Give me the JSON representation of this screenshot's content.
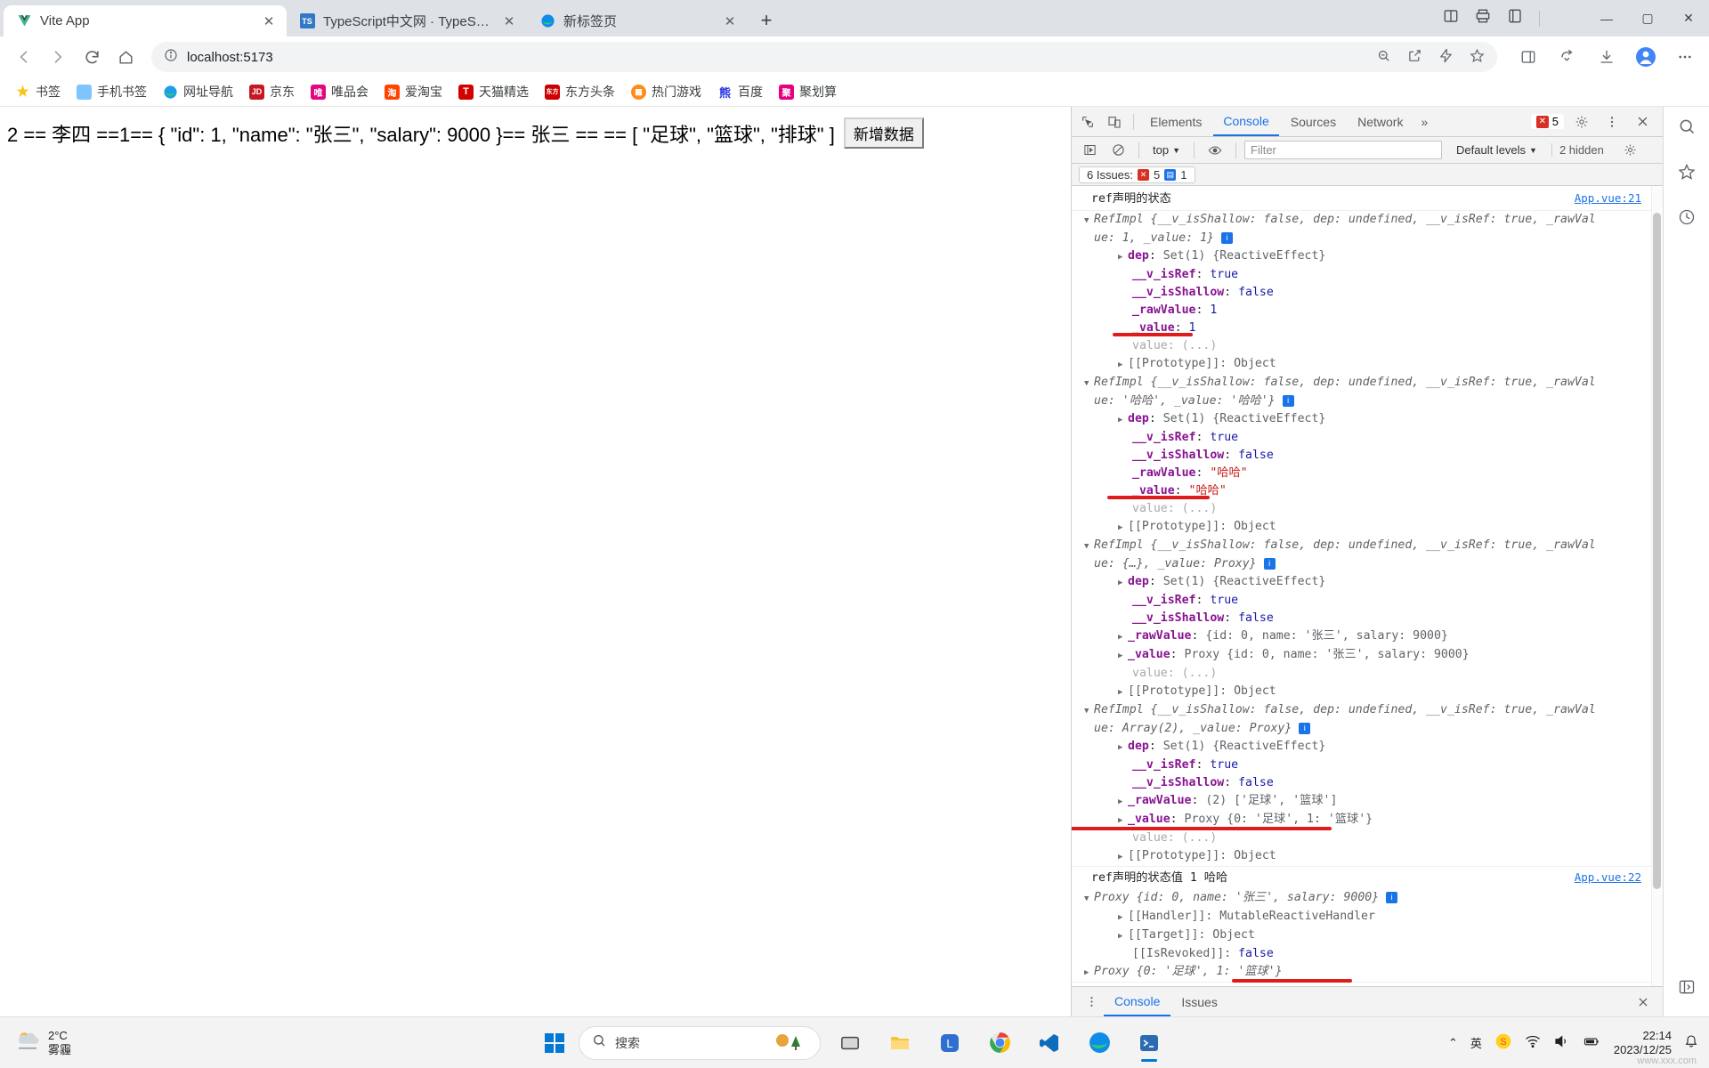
{
  "browser": {
    "tabs": [
      {
        "title": "Vite App",
        "favicon": "vue-logo-icon",
        "active": true
      },
      {
        "title": "TypeScript中文网 · TypeScript—",
        "favicon": "typescript-icon",
        "active": false
      },
      {
        "title": "新标签页",
        "favicon": "edge-icon",
        "active": false
      }
    ],
    "new_tab_label": "+",
    "window_controls": {
      "minimize": "—",
      "maximize": "▢",
      "close": "✕"
    },
    "toolbar": {
      "back": "←",
      "forward": "→",
      "reload": "⟳",
      "home": "⌂",
      "url": "localhost:5173",
      "site_info_icon": "info-circle-icon"
    },
    "bookmarks": [
      {
        "label": "书签",
        "icon": "star-icon",
        "color": "#f5c518",
        "glyph": "★"
      },
      {
        "label": "手机书签",
        "icon": "phone-icon",
        "color": "#7fc4fd",
        "glyph": "▯"
      },
      {
        "label": "网址导航",
        "icon": "edge-icon",
        "color": "#19b9e8",
        "glyph": "e"
      },
      {
        "label": "京东",
        "icon": "jd-icon",
        "color": "#c81623",
        "glyph": "JD"
      },
      {
        "label": "唯品会",
        "icon": "vip-icon",
        "color": "#e10682",
        "glyph": "唯"
      },
      {
        "label": "爱淘宝",
        "icon": "taobao-icon",
        "color": "#ff4400",
        "glyph": "淘"
      },
      {
        "label": "天猫精选",
        "icon": "tmall-icon",
        "color": "#d40000",
        "glyph": "T"
      },
      {
        "label": "东方头条",
        "icon": "dongfang-icon",
        "color": "#cc0000",
        "glyph": "东方"
      },
      {
        "label": "热门游戏",
        "icon": "games-icon",
        "color": "#ff8c1a",
        "glyph": "▦"
      },
      {
        "label": "百度",
        "icon": "baidu-icon",
        "color": "#2932e1",
        "glyph": "百"
      },
      {
        "label": "聚划算",
        "icon": "juhuasuan-icon",
        "color": "#e4007f",
        "glyph": "聚"
      }
    ]
  },
  "page": {
    "output_text": "2 == 李四 ==1== { \"id\": 1, \"name\": \"张三\", \"salary\": 9000 }== 张三 == == [ \"足球\", \"篮球\", \"排球\" ]",
    "button_label": "新增数据"
  },
  "devtools": {
    "tabs": [
      {
        "label": "Elements",
        "active": false
      },
      {
        "label": "Console",
        "active": true
      },
      {
        "label": "Sources",
        "active": false
      },
      {
        "label": "Network",
        "active": false
      }
    ],
    "more_tabs": "»",
    "inspect_icon": "inspect-cursor-icon",
    "device_icon": "device-toggle-icon",
    "error_count": "5",
    "settings_icon": "gear-icon",
    "menu_icon": "kebab-menu-icon",
    "close_icon": "close-icon",
    "toolbar2": {
      "execute_icon": "execute-snippet-icon",
      "clear_icon": "clear-console-icon",
      "context": "top",
      "eye_icon": "live-expression-icon",
      "filter_placeholder": "Filter",
      "levels": "Default levels",
      "hidden": "2 hidden"
    },
    "issues": {
      "prefix": "6 Issues:",
      "errors": "5",
      "infos": "1"
    },
    "logs": [
      {
        "group_title": "ref声明的状态",
        "source": "App.vue:21",
        "entries": [
          {
            "header_l1": "RefImpl {__v_isShallow: false, dep: undefined, __v_isRef: true, _rawVal",
            "header_l2": "ue: 1, _value: 1}",
            "props": [
              {
                "key": "dep",
                "value": "Set(1) {ReactiveEffect}",
                "expandable": true
              },
              {
                "key": "__v_isRef",
                "value": "true",
                "type": "bool"
              },
              {
                "key": "__v_isShallow",
                "value": "false",
                "type": "bool"
              },
              {
                "key": "_rawValue",
                "value": "1",
                "type": "num"
              },
              {
                "key": "_value",
                "value": "1",
                "type": "num",
                "underlined": true
              },
              {
                "key": "value",
                "value": "(...)",
                "faded": true
              },
              {
                "key": "[[Prototype]]",
                "value": "Object",
                "expandable": true,
                "proto": true
              }
            ]
          },
          {
            "header_l1": "RefImpl {__v_isShallow: false, dep: undefined, __v_isRef: true, _rawVal",
            "header_l2": "ue: '哈哈', _value: '哈哈'}",
            "props": [
              {
                "key": "dep",
                "value": "Set(1) {ReactiveEffect}",
                "expandable": true
              },
              {
                "key": "__v_isRef",
                "value": "true",
                "type": "bool"
              },
              {
                "key": "__v_isShallow",
                "value": "false",
                "type": "bool"
              },
              {
                "key": "_rawValue",
                "value": "\"哈哈\"",
                "type": "str"
              },
              {
                "key": "_value",
                "value": "\"哈哈\"",
                "type": "str",
                "underlined": true
              },
              {
                "key": "value",
                "value": "(...)",
                "faded": true
              },
              {
                "key": "[[Prototype]]",
                "value": "Object",
                "expandable": true,
                "proto": true
              }
            ]
          },
          {
            "header_l1": "RefImpl {__v_isShallow: false, dep: undefined, __v_isRef: true, _rawVal",
            "header_l2": "ue: {…}, _value: Proxy}",
            "props": [
              {
                "key": "dep",
                "value": "Set(1) {ReactiveEffect}",
                "expandable": true
              },
              {
                "key": "__v_isRef",
                "value": "true",
                "type": "bool"
              },
              {
                "key": "__v_isShallow",
                "value": "false",
                "type": "bool"
              },
              {
                "key": "_rawValue",
                "value": "{id: 0, name: '张三', salary: 9000}",
                "expandable": true
              },
              {
                "key": "_value",
                "value": "Proxy {id: 0, name: '张三', salary: 9000}",
                "expandable": true
              },
              {
                "key": "value",
                "value": "(...)",
                "faded": true
              },
              {
                "key": "[[Prototype]]",
                "value": "Object",
                "expandable": true,
                "proto": true
              }
            ]
          },
          {
            "header_l1": "RefImpl {__v_isShallow: false, dep: undefined, __v_isRef: true, _rawVal",
            "header_l2": "ue: Array(2), _value: Proxy}",
            "props": [
              {
                "key": "dep",
                "value": "Set(1) {ReactiveEffect}",
                "expandable": true
              },
              {
                "key": "__v_isRef",
                "value": "true",
                "type": "bool"
              },
              {
                "key": "__v_isShallow",
                "value": "false",
                "type": "bool"
              },
              {
                "key": "_rawValue",
                "value": "(2) ['足球', '篮球']",
                "expandable": true
              },
              {
                "key": "_value",
                "value": "Proxy {0: '足球', 1: '篮球'}",
                "expandable": true,
                "underlined": true
              },
              {
                "key": "value",
                "value": "(...)",
                "faded": true
              },
              {
                "key": "[[Prototype]]",
                "value": "Object",
                "expandable": true,
                "proto": true
              }
            ]
          }
        ]
      },
      {
        "group_title": "ref声明的状态值 1 哈哈",
        "source": "App.vue:22",
        "proxy_entries": [
          {
            "header": "Proxy {id: 0, name: '张三', salary: 9000}",
            "props": [
              {
                "key": "[[Handler]]",
                "value": "MutableReactiveHandler",
                "expandable": true
              },
              {
                "key": "[[Target]]",
                "value": "Object",
                "expandable": true
              },
              {
                "key": "[[IsRevoked]]",
                "value": "false",
                "type": "bool"
              }
            ]
          },
          {
            "header": "Proxy {0: '足球', 1: '篮球'}",
            "underlined": true,
            "props": []
          }
        ]
      }
    ],
    "prompt": ">",
    "drawer_tabs": [
      {
        "label": "Console",
        "active": true
      },
      {
        "label": "Issues",
        "active": false
      }
    ],
    "drawer_menu_icon": "kebab-menu-icon",
    "drawer_close_icon": "close-icon"
  },
  "rail": {
    "search_icon": "search-icon",
    "favorites_icon": "star-outline-icon",
    "history_icon": "clock-icon",
    "expand_icon": "panel-expand-icon"
  },
  "taskbar": {
    "weather": {
      "temp": "2°C",
      "condition": "雾霾",
      "icon": "haze-icon"
    },
    "start_icon": "windows-start-icon",
    "search_placeholder": "搜索",
    "search_icon": "search-icon",
    "apps": [
      {
        "name": "task-view",
        "glyph": "▭"
      },
      {
        "name": "file-explorer",
        "glyph": "🗀"
      },
      {
        "name": "line-app",
        "glyph": "L"
      },
      {
        "name": "chrome",
        "glyph": "◉"
      },
      {
        "name": "vscode",
        "glyph": "◈"
      },
      {
        "name": "edge",
        "glyph": "e"
      },
      {
        "name": "terminal",
        "glyph": "▣"
      }
    ],
    "tray": {
      "chevron": "⌃",
      "ime": "英",
      "app": "S",
      "wifi_icon": "wifi-icon",
      "volume_icon": "volume-icon",
      "battery_icon": "battery-icon"
    },
    "time": "22:14",
    "date": "2023/12/25",
    "watermark": "www.xxx.com"
  }
}
